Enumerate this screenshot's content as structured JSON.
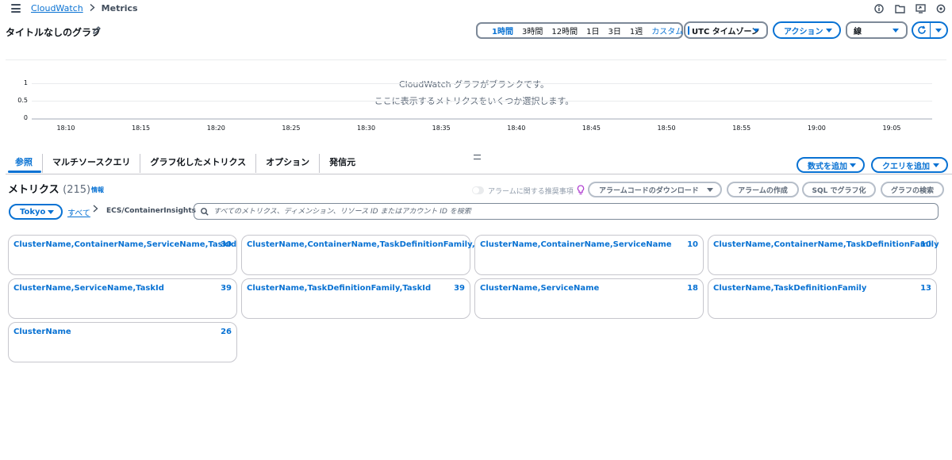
{
  "breadcrumb": {
    "service": "CloudWatch",
    "current": "Metrics"
  },
  "top_icons": [
    "info-icon",
    "folder-icon",
    "screen-share-icon",
    "settings-icon"
  ],
  "graph": {
    "title": "タイトルなしのグラフ",
    "time_ranges": [
      "1時間",
      "3時間",
      "12時間",
      "1日",
      "3日",
      "1週"
    ],
    "time_range_active": "1時間",
    "custom_label": "カスタム",
    "timezone": "UTC タイムゾーン",
    "actions": "アクション",
    "chart_type": "線",
    "empty_line1": "CloudWatch グラフがブランクです。",
    "empty_line2": "ここに表示するメトリクスをいくつか選択します。"
  },
  "chart_data": {
    "type": "line",
    "y_ticks": [
      "1",
      "0.5",
      "0"
    ],
    "ylim": [
      0,
      1
    ],
    "x_ticks": [
      "18:10",
      "18:15",
      "18:20",
      "18:25",
      "18:30",
      "18:35",
      "18:40",
      "18:45",
      "18:50",
      "18:55",
      "19:00",
      "19:05"
    ],
    "series": [],
    "grid": true
  },
  "tabs": [
    "参照",
    "マルチソースクエリ",
    "グラフ化したメトリクス",
    "オプション",
    "発信元"
  ],
  "tab_active": "参照",
  "buttons": {
    "add_math": "数式を追加",
    "add_query": "クエリを追加",
    "download_alarm_code": "アラームコードのダウンロード",
    "create_alarm": "アラームの作成",
    "graph_with_sql": "SQL でグラフ化",
    "search_graph": "グラフの検索"
  },
  "metrics": {
    "title": "メトリクス",
    "count": "(215)",
    "info": "情報",
    "alarm_recommendation": "アラームに関する推奨事項",
    "region": "Tokyo",
    "all": "すべて",
    "namespace": "ECS/ContainerInsights",
    "search_placeholder": "すべてのメトリクス、ディメンション、リソース ID またはアカウント ID を検索"
  },
  "cards": [
    {
      "name": "ClusterName,ContainerName,ServiceName,TaskId",
      "count": "30"
    },
    {
      "name": "ClusterName,ContainerName,TaskDefinitionFamily,TaskId",
      "count": ""
    },
    {
      "name": "ClusterName,ContainerName,ServiceName",
      "count": "10"
    },
    {
      "name": "ClusterName,ContainerName,TaskDefinitionFamily",
      "count": "10"
    },
    {
      "name": "ClusterName,ServiceName,TaskId",
      "count": "39"
    },
    {
      "name": "ClusterName,TaskDefinitionFamily,TaskId",
      "count": "39"
    },
    {
      "name": "ClusterName,ServiceName",
      "count": "18"
    },
    {
      "name": "ClusterName,TaskDefinitionFamily",
      "count": "13"
    },
    {
      "name": "ClusterName",
      "count": "26"
    }
  ]
}
